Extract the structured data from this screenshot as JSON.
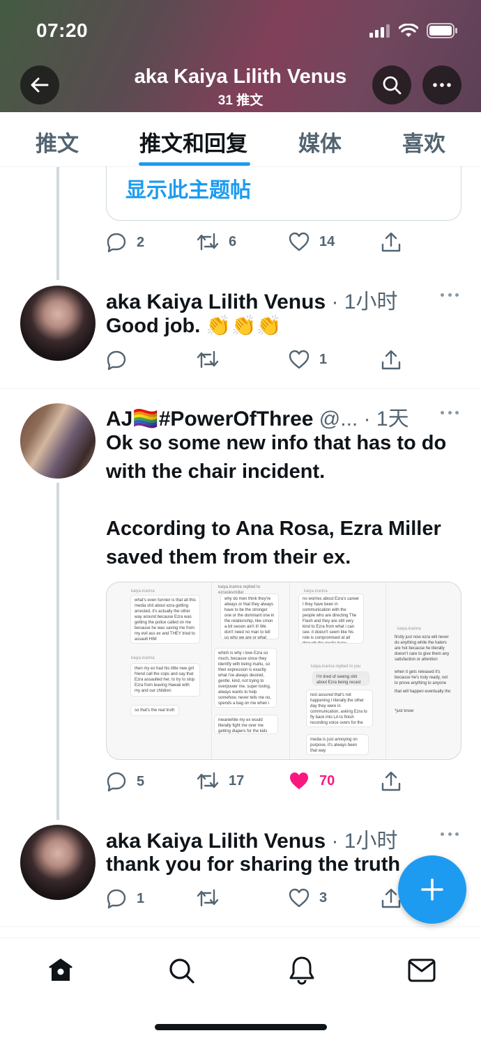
{
  "status_bar": {
    "time": "07:20"
  },
  "header": {
    "title": "aka Kaiya Lilith Venus",
    "subtitle": "31 推文"
  },
  "tabs": [
    {
      "label": "推文"
    },
    {
      "label": "推文和回复"
    },
    {
      "label": "媒体"
    },
    {
      "label": "喜欢"
    }
  ],
  "show_thread": "显示此主题帖",
  "tweet0_actions": {
    "replies": "2",
    "retweets": "6",
    "likes": "14"
  },
  "tweet1": {
    "name": "aka Kaiya Lilith Venus",
    "time": "· 1小时",
    "text": "Good job. 👏👏👏",
    "replies": "",
    "retweets": "",
    "likes": "1"
  },
  "tweet2": {
    "name": "AJ🏳️‍🌈#PowerOfThree",
    "handle": "@...",
    "time": "· 1天",
    "text_p1": "Ok so some new info that has to do with the chair incident.",
    "text_p2": "According to Ana Rosa, Ezra Miller saved them from their ex.",
    "replies": "5",
    "retweets": "17",
    "likes": "70"
  },
  "tweet3": {
    "name": "aka Kaiya Lilith Venus",
    "time": "· 1小时",
    "text": "thank you for sharing the truth",
    "replies": "1",
    "retweets": "",
    "likes": "3"
  },
  "media_text": {
    "c1a": "kaiya.inanna",
    "c1b": "what's even funnier is that all this media shit about ezra getting arrested, it's actually the other way around because Ezra was getting the police called on me because he was saving me from my evil ass ex and THEY tried to assault HIM",
    "c1c": "kaiya.inanna",
    "c1d": "then my ex had his little new girl friend call the cops and say that Ezra assaulted her, to try to stop Ezra from leaving Hawaii with my and our children",
    "c1e": "so that's the real truth",
    "c2a": "kaiya.inanna replied to ezrasleymiller",
    "c2b": "why do men think they're always or that they always have to be the stronger one or the dominant one in the relationship, like cmon a bit swoon ain't it! We don't need no man to tell us who we are or what rolls we have in a relationship",
    "c2c": "which is why i love Ezra so much, because since they identify with being mahu, so their expression is exactly what i've always desired, gentle, kind, not trying to overpower me, super loving, always wants to help somehow, never tells me no, spends a bag on me when i haven't even asked",
    "c2d": "meanwhile my ex would literally fight me over me getting diapers for the kids with his card",
    "c3a": "kaiya.inanna",
    "c3b": "no worries about Ezra's career I they have been in communication with the people who are directing The Flash and they are still very kind to Ezra from what i can see. it doesn't seem like his role is compromised at all through the media hype",
    "c3c": "kaiya.inanna replied to you",
    "c3d": "I'm tired of seeing shit about Ezra being recast as Flash",
    "c3e": "rest assured that's not happening I literally the other day they were in communication, asking Ezra to fly back into LA to finish recording voice overs for the movie",
    "c3f": "media is just annoying on purpose, it's always been that way",
    "c4a": "kaiya.inanna",
    "c4b": "firstly just now ezra will never do anything while the haters are hot because he literally doesn't care to give them any satisfaction or attention",
    "c4c": "when it gets released it's because he's truly ready, not to prove anything to anyone",
    "c4d": "that will happen eventually tho",
    "c4e": "*just know"
  },
  "colors": {
    "accent": "#1d9bf0",
    "like": "#f91880",
    "secondary_text": "#536471"
  },
  "bottom_nav": [
    {
      "icon": "home-icon"
    },
    {
      "icon": "search-icon"
    },
    {
      "icon": "bell-icon"
    },
    {
      "icon": "mail-icon"
    }
  ]
}
